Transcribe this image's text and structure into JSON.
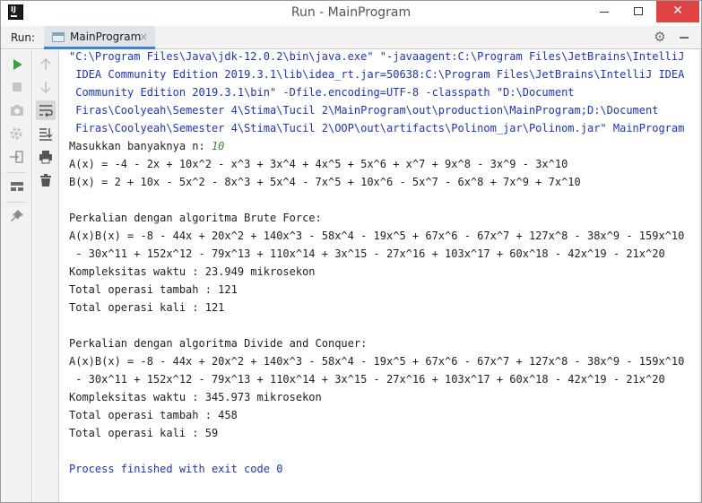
{
  "window": {
    "title": "Run - MainProgram",
    "app_icon_text": "IJ"
  },
  "runbar": {
    "label": "Run:",
    "tab_label": "MainProgram",
    "tab_close": "×"
  },
  "console": {
    "command_lines": [
      "\"C:\\Program Files\\Java\\jdk-12.0.2\\bin\\java.exe\" \"-javaagent:C:\\Program Files\\JetBrains\\IntelliJ",
      " IDEA Community Edition 2019.3.1\\lib\\idea_rt.jar=50638:C:\\Program Files\\JetBrains\\IntelliJ IDEA",
      " Community Edition 2019.3.1\\bin\" -Dfile.encoding=UTF-8 -classpath \"D:\\Document",
      " Firas\\Coolyeah\\Semester 4\\Stima\\Tucil 2\\MainProgram\\out\\production\\MainProgram;D:\\Document",
      " Firas\\Coolyeah\\Semester 4\\Stima\\Tucil 2\\OOP\\out\\artifacts\\Polinom_jar\\Polinom.jar\" MainProgram"
    ],
    "prompt_label": "Masukkan banyaknya n: ",
    "prompt_input": "10",
    "ax": "A(x) = -4 - 2x + 10x^2 - x^3 + 3x^4 + 4x^5 + 5x^6 + x^7 + 9x^8 - 3x^9 - 3x^10",
    "bx": "B(x) = 2 + 10x - 5x^2 - 8x^3 + 5x^4 - 7x^5 + 10x^6 - 5x^7 - 6x^8 + 7x^9 + 7x^10",
    "brute": {
      "heading": "Perkalian dengan algoritma Brute Force:",
      "result_1": "A(x)B(x) = -8 - 44x + 20x^2 + 140x^3 - 58x^4 - 19x^5 + 67x^6 - 67x^7 + 127x^8 - 38x^9 - 159x^10",
      "result_2": " - 30x^11 + 152x^12 - 79x^13 + 110x^14 + 3x^15 - 27x^16 + 103x^17 + 60x^18 - 42x^19 - 21x^20",
      "time": "Kompleksitas waktu : 23.949 mikrosekon",
      "add_ops": "Total operasi tambah : 121",
      "mul_ops": "Total operasi kali : 121"
    },
    "dnc": {
      "heading": "Perkalian dengan algoritma Divide and Conquer:",
      "result_1": "A(x)B(x) = -8 - 44x + 20x^2 + 140x^3 - 58x^4 - 19x^5 + 67x^6 - 67x^7 + 127x^8 - 38x^9 - 159x^10",
      "result_2": " - 30x^11 + 152x^12 - 79x^13 + 110x^14 + 3x^15 - 27x^16 + 103x^17 + 60x^18 - 42x^19 - 21x^20",
      "time": "Kompleksitas waktu : 345.973 mikrosekon",
      "add_ops": "Total operasi tambah : 458",
      "mul_ops": "Total operasi kali : 59"
    },
    "exit_line": "Process finished with exit code 0"
  },
  "icons": {
    "toolbar_left": [
      "run-icon",
      "stop-icon",
      "camera-icon",
      "debug-settings-icon",
      "login-icon",
      "layout-icon",
      "pin-icon"
    ],
    "toolbar_right": [
      "up-arrow-icon",
      "down-arrow-icon",
      "soft-wrap-icon",
      "scroll-to-end-icon",
      "print-icon",
      "trash-icon"
    ]
  },
  "colors": {
    "run_green": "#3ea143",
    "console_blue": "#1c35b5",
    "input_green": "#3a8a3a",
    "close_red": "#e04343",
    "tab_accent": "#4083c9"
  }
}
